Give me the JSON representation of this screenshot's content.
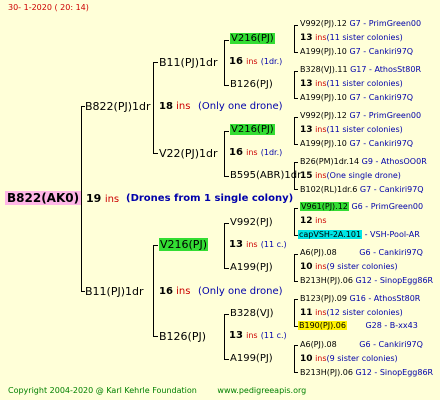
{
  "header": {
    "date": "30-   1-2020 (  20:  14)"
  },
  "root": {
    "name": "B822(AK0)",
    "count": "19",
    "ins": "ins",
    "note": "(Drones from 1 single colony)"
  },
  "gen1": {
    "top": {
      "name": "B822(PJ)1dr",
      "count": "18",
      "ins": "ins",
      "note": "(Only one drone)"
    },
    "bottom": {
      "name": "B11(PJ)1dr",
      "count": "16",
      "ins": "ins",
      "note": "(Only one drone)"
    }
  },
  "gen2": {
    "a": {
      "name": "B11(PJ)1dr",
      "count": "16",
      "ins": "ins",
      "note": "(1dr.)"
    },
    "b": {
      "name": "V22(PJ)1dr",
      "count": "16",
      "ins": "ins",
      "note": "(1dr.)"
    },
    "c": {
      "name": "V216(PJ)",
      "count": "13",
      "ins": "ins",
      "note": "(11 c.)"
    },
    "d": {
      "name": "B126(PJ)",
      "count": "13",
      "ins": "ins",
      "note": "(11 c.)"
    }
  },
  "gen3": {
    "a1": {
      "name": "V216(PJ)",
      "count": "13",
      "ins": "ins",
      "note": "(11 sister colonies)"
    },
    "a2": {
      "name": "B126(PJ)"
    },
    "b1": {
      "name": "V216(PJ)",
      "count": "13",
      "ins": "ins",
      "note": "(11 sister colonies)"
    },
    "b2": {
      "name": "B595(ABR)1dr",
      "count": "15",
      "ins": "ins",
      "note": "(One single drone)"
    },
    "c1": {
      "name": "V992(PJ)",
      "count": "12",
      "ins": "ins"
    },
    "c2": {
      "name": "A199(PJ)",
      "count": "10",
      "ins": "ins",
      "note": "(9 sister colonies)"
    },
    "d1": {
      "name": "B328(VJ)",
      "count": "11",
      "ins": "ins",
      "note": "(12 sister colonies)"
    },
    "d2": {
      "name": "A199(PJ)",
      "count": "10",
      "ins": "ins",
      "note": "(9 sister colonies)"
    }
  },
  "gen4": {
    "r1": {
      "name": "V992(PJ).12",
      "info": "G7 - PrimGreen00"
    },
    "r2": {
      "name": "A199(PJ).10",
      "info": "G7 - Cankiri97Q"
    },
    "r3": {
      "name": "B328(VJ).11",
      "info": "G17 - AthosSt80R"
    },
    "r4": {
      "name": "A199(PJ).10",
      "info": "G7 - Cankiri97Q"
    },
    "r5": {
      "name": "V992(PJ).12",
      "info": "G7 - PrimGreen00"
    },
    "r6": {
      "name": "A199(PJ).10",
      "info": "G7 - Cankiri97Q"
    },
    "r7": {
      "name": "B26(PM)1dr.14",
      "info": "G9 - AthosOO0R"
    },
    "r8": {
      "name": "B102(RL)1dr.6",
      "info": "G7 - Cankiri97Q"
    },
    "r9": {
      "name": "V961(PJ).12",
      "info": "G6 - PrimGreen00"
    },
    "r10": {
      "name": "capVSH-2A.101",
      "info": "- VSH-Pool-AR"
    },
    "r11": {
      "name": "A6(PJ).08",
      "info": "G6 - Cankiri97Q"
    },
    "r12": {
      "name": "B213H(PJ).06",
      "info": "G12 - SinopEgg86R"
    },
    "r13": {
      "name": "B123(PJ).09",
      "info": "G16 - AthosSt80R"
    },
    "r14": {
      "name": "B190(PJ).06",
      "info": "G28 - B-xx43"
    },
    "r15": {
      "name": "A6(PJ).08",
      "info": "G6 - Cankiri97Q"
    },
    "r16": {
      "name": "B213H(PJ).06",
      "info": "G12 - SinopEgg86R"
    }
  },
  "footer": {
    "copyright": "Copyright 2004-2020 @ Karl Kehrle Foundation",
    "site": "www.pedigreeapis.org"
  }
}
